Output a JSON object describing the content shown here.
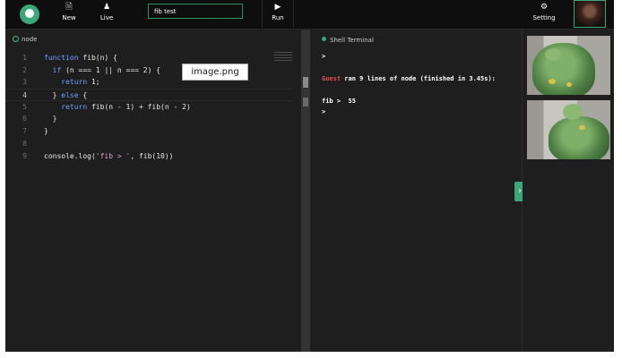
{
  "toolbar": {
    "new_label": "New",
    "live_label": "Live",
    "title_value": "fib test",
    "run_label": "Run",
    "setting_label": "Setting",
    "icons": {
      "new": "document-icon",
      "live": "people-icon",
      "run": "play-icon",
      "setting": "gear-icon"
    }
  },
  "editor": {
    "tab_label": "node",
    "lines": [
      {
        "n": "1",
        "code": "function fib(n) {"
      },
      {
        "n": "2",
        "code": "  if (n === 1 || n === 2) {"
      },
      {
        "n": "3",
        "code": "    return 1;"
      },
      {
        "n": "4",
        "code": "  } else {"
      },
      {
        "n": "5",
        "code": "    return fib(n - 1) + fib(n - 2)"
      },
      {
        "n": "6",
        "code": "  }"
      },
      {
        "n": "7",
        "code": "}"
      },
      {
        "n": "8",
        "code": ""
      },
      {
        "n": "9",
        "code": "console.log('fib > ', fib(10))"
      }
    ],
    "tooltip": "image.png"
  },
  "terminal": {
    "title": "Shell Terminal",
    "prompt1": ">",
    "guest": "Guest",
    "run_message": " ran 9 lines of node (finished in 3.45s):",
    "output": "fib >  55",
    "prompt2": ">"
  },
  "colors": {
    "accent": "#3aa67a",
    "keyword": "#6fa0ff",
    "string": "#d9a0d0",
    "guest": "#e05050"
  }
}
